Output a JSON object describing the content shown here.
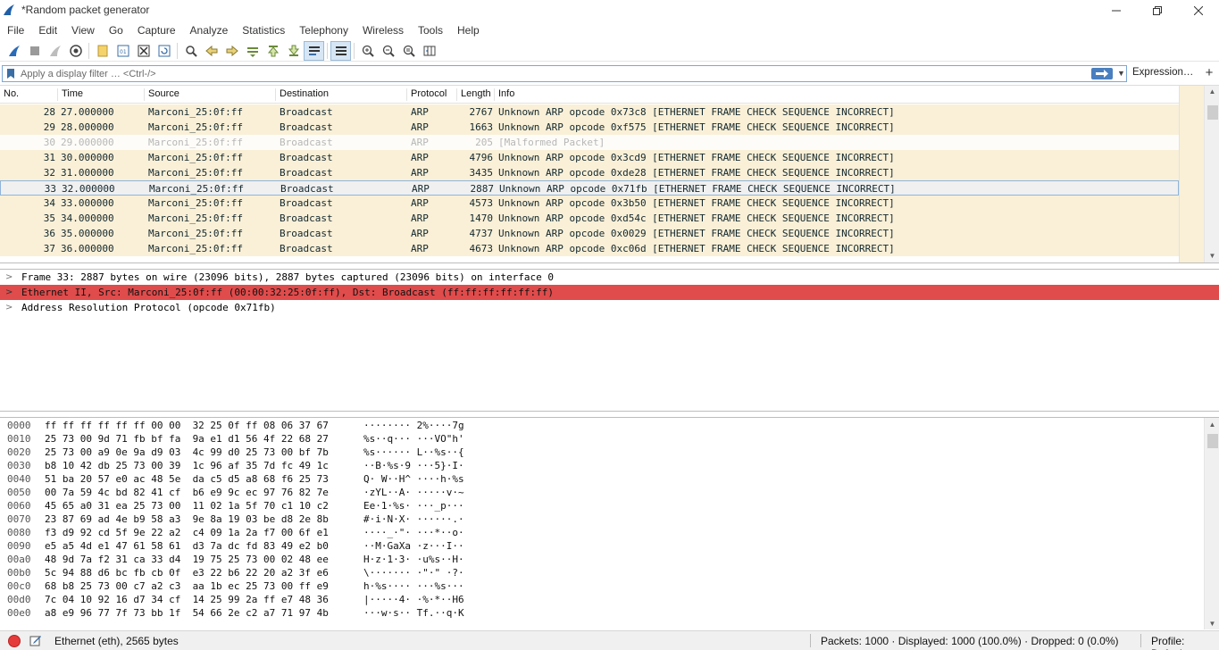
{
  "window": {
    "title": "*Random packet generator",
    "controls": [
      "minimize-icon",
      "maximize-icon",
      "close-icon"
    ]
  },
  "menu": [
    "File",
    "Edit",
    "View",
    "Go",
    "Capture",
    "Analyze",
    "Statistics",
    "Telephony",
    "Wireless",
    "Tools",
    "Help"
  ],
  "toolbar_icons": [
    "start-capture-icon",
    "stop-capture-icon",
    "restart-capture-icon",
    "capture-options-icon",
    "open-file-icon",
    "save-file-icon",
    "close-file-icon",
    "reload-file-icon",
    "find-packet-icon",
    "go-back-icon",
    "go-forward-icon",
    "go-to-packet-icon",
    "go-first-icon",
    "go-last-icon",
    "auto-scroll-icon",
    "colorize-icon",
    "zoom-in-icon",
    "zoom-out-icon",
    "zoom-normal-icon",
    "resize-columns-icon"
  ],
  "filter": {
    "placeholder": "Apply a display filter … <Ctrl-/>",
    "expression_label": "Expression…",
    "add_label": "+"
  },
  "packet_list": {
    "columns": [
      "No.",
      "Time",
      "Source",
      "Destination",
      "Protocol",
      "Length",
      "Info"
    ],
    "selected_no": "33",
    "rows": [
      {
        "no": "28",
        "time": "27.000000",
        "src": "Marconi_25:0f:ff",
        "dst": "Broadcast",
        "proto": "ARP",
        "len": "2767",
        "info": "Unknown ARP opcode 0x73c8 [ETHERNET FRAME CHECK SEQUENCE INCORRECT]",
        "style": "normal"
      },
      {
        "no": "29",
        "time": "28.000000",
        "src": "Marconi_25:0f:ff",
        "dst": "Broadcast",
        "proto": "ARP",
        "len": "1663",
        "info": "Unknown ARP opcode 0xf575 [ETHERNET FRAME CHECK SEQUENCE INCORRECT]",
        "style": "normal"
      },
      {
        "no": "30",
        "time": "29.000000",
        "src": "Marconi_25:0f:ff",
        "dst": "Broadcast",
        "proto": "ARP",
        "len": "205",
        "info": "[Malformed Packet]",
        "style": "malformed"
      },
      {
        "no": "31",
        "time": "30.000000",
        "src": "Marconi_25:0f:ff",
        "dst": "Broadcast",
        "proto": "ARP",
        "len": "4796",
        "info": "Unknown ARP opcode 0x3cd9 [ETHERNET FRAME CHECK SEQUENCE INCORRECT]",
        "style": "normal"
      },
      {
        "no": "32",
        "time": "31.000000",
        "src": "Marconi_25:0f:ff",
        "dst": "Broadcast",
        "proto": "ARP",
        "len": "3435",
        "info": "Unknown ARP opcode 0xde28 [ETHERNET FRAME CHECK SEQUENCE INCORRECT]",
        "style": "normal"
      },
      {
        "no": "33",
        "time": "32.000000",
        "src": "Marconi_25:0f:ff",
        "dst": "Broadcast",
        "proto": "ARP",
        "len": "2887",
        "info": "Unknown ARP opcode 0x71fb [ETHERNET FRAME CHECK SEQUENCE INCORRECT]",
        "style": "selected"
      },
      {
        "no": "34",
        "time": "33.000000",
        "src": "Marconi_25:0f:ff",
        "dst": "Broadcast",
        "proto": "ARP",
        "len": "4573",
        "info": "Unknown ARP opcode 0x3b50 [ETHERNET FRAME CHECK SEQUENCE INCORRECT]",
        "style": "normal"
      },
      {
        "no": "35",
        "time": "34.000000",
        "src": "Marconi_25:0f:ff",
        "dst": "Broadcast",
        "proto": "ARP",
        "len": "1470",
        "info": "Unknown ARP opcode 0xd54c [ETHERNET FRAME CHECK SEQUENCE INCORRECT]",
        "style": "normal"
      },
      {
        "no": "36",
        "time": "35.000000",
        "src": "Marconi_25:0f:ff",
        "dst": "Broadcast",
        "proto": "ARP",
        "len": "4737",
        "info": "Unknown ARP opcode 0x0029 [ETHERNET FRAME CHECK SEQUENCE INCORRECT]",
        "style": "normal"
      },
      {
        "no": "37",
        "time": "36.000000",
        "src": "Marconi_25:0f:ff",
        "dst": "Broadcast",
        "proto": "ARP",
        "len": "4673",
        "info": "Unknown ARP opcode 0xc06d [ETHERNET FRAME CHECK SEQUENCE INCORRECT]",
        "style": "normal"
      }
    ]
  },
  "details": [
    {
      "text": "Frame 33: 2887 bytes on wire (23096 bits), 2887 bytes captured (23096 bits) on interface 0",
      "style": "normal"
    },
    {
      "text": "Ethernet II, Src: Marconi_25:0f:ff (00:00:32:25:0f:ff), Dst: Broadcast (ff:ff:ff:ff:ff:ff)",
      "style": "error"
    },
    {
      "text": "Address Resolution Protocol (opcode 0x71fb)",
      "style": "normal"
    }
  ],
  "bytes": [
    {
      "off": "0000",
      "hex": "ff ff ff ff ff ff 00 00  32 25 0f ff 08 06 37 67",
      "ascii": "········ 2%····7g"
    },
    {
      "off": "0010",
      "hex": "25 73 00 9d 71 fb bf fa  9a e1 d1 56 4f 22 68 27",
      "ascii": "%s··q··· ···VO\"h'"
    },
    {
      "off": "0020",
      "hex": "25 73 00 a9 0e 9a d9 03  4c 99 d0 25 73 00 bf 7b",
      "ascii": "%s······ L··%s··{"
    },
    {
      "off": "0030",
      "hex": "b8 10 42 db 25 73 00 39  1c 96 af 35 7d fc 49 1c",
      "ascii": "··B·%s·9 ···5}·I·"
    },
    {
      "off": "0040",
      "hex": "51 ba 20 57 e0 ac 48 5e  da c5 d5 a8 68 f6 25 73",
      "ascii": "Q· W··H^ ····h·%s"
    },
    {
      "off": "0050",
      "hex": "00 7a 59 4c bd 82 41 cf  b6 e9 9c ec 97 76 82 7e",
      "ascii": "·zYL··A· ·····v·~"
    },
    {
      "off": "0060",
      "hex": "45 65 a0 31 ea 25 73 00  11 02 1a 5f 70 c1 10 c2",
      "ascii": "Ee·1·%s· ···_p···"
    },
    {
      "off": "0070",
      "hex": "23 87 69 ad 4e b9 58 a3  9e 8a 19 03 be d8 2e 8b",
      "ascii": "#·i·N·X· ······.·"
    },
    {
      "off": "0080",
      "hex": "f3 d9 92 cd 5f 9e 22 a2  c4 09 1a 2a f7 00 6f e1",
      "ascii": "····_·\"· ···*··o·"
    },
    {
      "off": "0090",
      "hex": "e5 a5 4d e1 47 61 58 61  d3 7a dc fd 83 49 e2 b0",
      "ascii": "··M·GaXa ·z···I··"
    },
    {
      "off": "00a0",
      "hex": "48 9d 7a f2 31 ca 33 d4  19 75 25 73 00 02 48 ee",
      "ascii": "H·z·1·3· ·u%s··H·"
    },
    {
      "off": "00b0",
      "hex": "5c 94 88 d6 bc fb cb 0f  e3 22 b6 22 20 a2 3f e6",
      "ascii": "\\······· ·\"·\" ·?·"
    },
    {
      "off": "00c0",
      "hex": "68 b8 25 73 00 c7 a2 c3  aa 1b ec 25 73 00 ff e9",
      "ascii": "h·%s···· ···%s···"
    },
    {
      "off": "00d0",
      "hex": "7c 04 10 92 16 d7 34 cf  14 25 99 2a ff e7 48 36",
      "ascii": "|·····4· ·%·*··H6"
    },
    {
      "off": "00e0",
      "hex": "a8 e9 96 77 7f 73 bb 1f  54 66 2e c2 a7 71 97 4b",
      "ascii": "···w·s·· Tf.··q·K"
    }
  ],
  "status": {
    "left_text": "Ethernet (eth), 2565 bytes",
    "packets_text": "Packets: 1000 · Displayed: 1000 (100.0%) · Dropped: 0 (0.0%)",
    "profile_text": "Profile: Default"
  },
  "colors": {
    "row_normal": "#faf0d7",
    "row_malformed_text": "#b7b7b7",
    "error_row": "#e04b4b",
    "selection_border": "#8fb4d9",
    "status_led": "#e53b3b"
  }
}
